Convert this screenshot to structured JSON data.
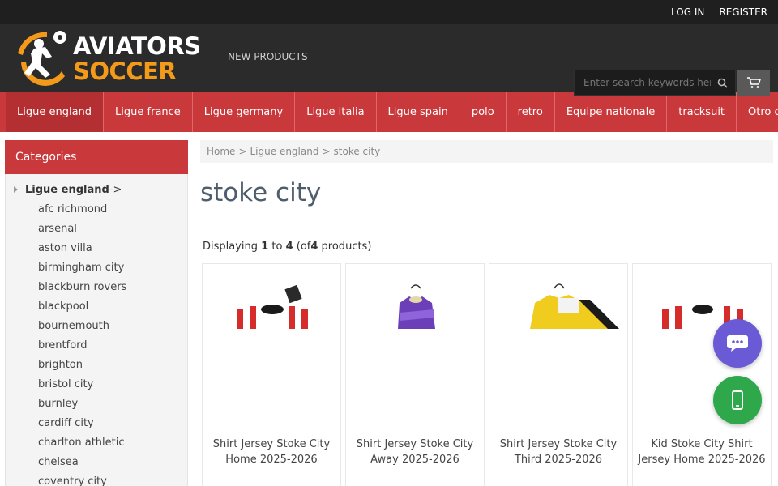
{
  "topbar": {
    "login": "LOG IN",
    "register": "REGISTER"
  },
  "header": {
    "logo_line1": "AVIATORS",
    "logo_line2": "SOCCER",
    "new_products": "NEW PRODUCTS",
    "search_placeholder": "Enter search keywords here"
  },
  "nav": {
    "items": [
      {
        "label": "Ligue england"
      },
      {
        "label": "Ligue france"
      },
      {
        "label": "Ligue germany"
      },
      {
        "label": "Ligue italia"
      },
      {
        "label": "Ligue spain"
      },
      {
        "label": "polo"
      },
      {
        "label": "retro"
      },
      {
        "label": "Equipe nationale"
      },
      {
        "label": "tracksuit"
      },
      {
        "label": "Otro club"
      }
    ]
  },
  "sidebar": {
    "title": "Categories",
    "parent": "Ligue england",
    "parent_suffix": "->",
    "items": [
      "afc richmond",
      "arsenal",
      "aston villa",
      "birmingham city",
      "blackburn rovers",
      "blackpool",
      "bournemouth",
      "brentford",
      "brighton",
      "bristol city",
      "burnley",
      "cardiff city",
      "charlton athletic",
      "chelsea",
      "coventry city"
    ]
  },
  "breadcrumb": {
    "home": "Home",
    "sep": ">",
    "level1": "Ligue england",
    "current": "stoke city"
  },
  "main": {
    "title": "stoke city",
    "displaying_prefix": "Displaying",
    "from": "1",
    "to_word": "to",
    "to": "4",
    "of_prefix": "(of",
    "total": "4",
    "of_suffix": "products)"
  },
  "products": [
    {
      "name": "Shirt Jersey Stoke City Home 2025-2026",
      "jersey": "red-white-stripes"
    },
    {
      "name": "Shirt Jersey Stoke City Away 2025-2026",
      "jersey": "purple"
    },
    {
      "name": "Shirt Jersey Stoke City Third 2025-2026",
      "jersey": "yellow-black"
    },
    {
      "name": "Kid Stoke City Shirt Jersey Home 2025-2026",
      "jersey": "red-white-stripes"
    }
  ],
  "colors": {
    "brand_red": "#c9393c",
    "brand_orange": "#f39a1b",
    "header_dark": "#2b2b2b"
  }
}
